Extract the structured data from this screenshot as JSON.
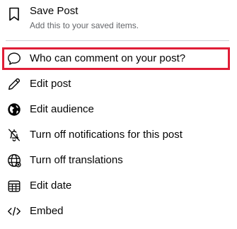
{
  "menu": {
    "save_post": {
      "title": "Save Post",
      "subtitle": "Add this to your saved items.",
      "icon": "bookmark-icon"
    },
    "items": [
      {
        "label": "Who can comment on your post?",
        "icon": "comment-bubble-icon",
        "highlighted": true
      },
      {
        "label": "Edit post",
        "icon": "pencil-icon"
      },
      {
        "label": "Edit audience",
        "icon": "globe-icon"
      },
      {
        "label": "Turn off notifications for this post",
        "icon": "bell-off-icon"
      },
      {
        "label": "Turn off translations",
        "icon": "translate-globe-icon"
      },
      {
        "label": "Edit date",
        "icon": "calendar-icon"
      },
      {
        "label": "Embed",
        "icon": "code-icon"
      }
    ]
  },
  "colors": {
    "highlight_border": "#e01e37",
    "text_primary": "#050505",
    "text_secondary": "#65676b",
    "divider": "#ced0d4"
  }
}
